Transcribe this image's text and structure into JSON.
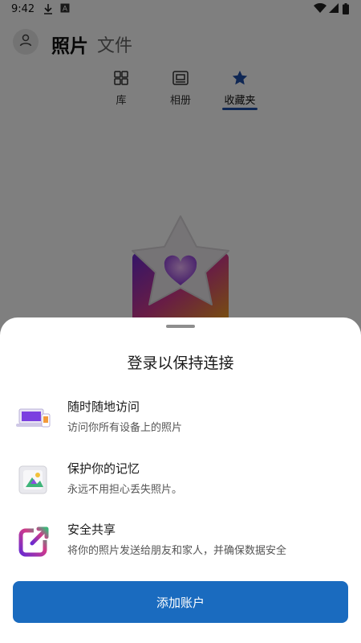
{
  "status_bar": {
    "time": "9:42",
    "download_icon": "download-icon",
    "a_icon": "a-box-icon",
    "wifi_icon": "wifi-icon",
    "signal_icon": "signal-icon",
    "battery_icon": "battery-icon"
  },
  "header": {
    "title_active": "照片",
    "title_inactive": "文件",
    "avatar_icon": "person-icon"
  },
  "tabs": [
    {
      "label": "库",
      "icon": "grid-icon",
      "active": false
    },
    {
      "label": "相册",
      "icon": "album-icon",
      "active": false
    },
    {
      "label": "收藏夹",
      "icon": "star-icon",
      "active": true
    }
  ],
  "colors": {
    "accent": "#1a6bbf",
    "tab_underline": "#1f4ea8",
    "overlay": "rgba(0,0,0,0.5)"
  },
  "sheet": {
    "title": "登录以保持连接",
    "features": [
      {
        "title": "随时随地访问",
        "description": "访问你所有设备上的照片",
        "icon": "devices-icon"
      },
      {
        "title": "保护你的记忆",
        "description": "永远不用担心丢失照片。",
        "icon": "photo-protect-icon"
      },
      {
        "title": "安全共享",
        "description": "将你的照片发送给朋友和家人，并确保数据安全",
        "icon": "share-icon"
      }
    ],
    "cta_label": "添加账户"
  }
}
